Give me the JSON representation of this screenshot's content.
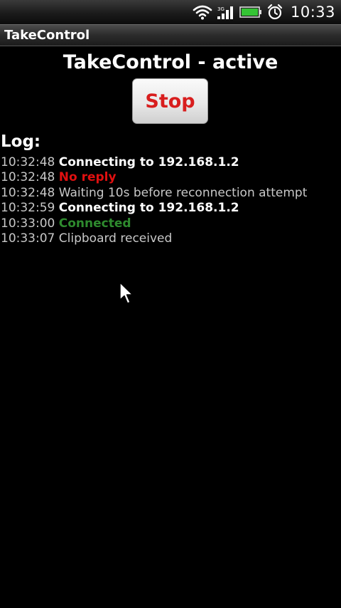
{
  "status_bar": {
    "time": "10:33",
    "icons": [
      "wifi-icon",
      "signal-icon",
      "battery-icon",
      "alarm-clock-icon"
    ],
    "battery_color": "#35c435"
  },
  "app": {
    "title": "TakeControl"
  },
  "main": {
    "heading": "TakeControl - active",
    "stop_button_label": "Stop",
    "log_label": "Log:",
    "log": [
      {
        "time": "10:32:48",
        "message": "Connecting to 192.168.1.2",
        "style": "bold-white"
      },
      {
        "time": "10:32:48",
        "message": "No reply",
        "style": "bold-red"
      },
      {
        "time": "10:32:48",
        "message": "Waiting 10s before reconnection attempt",
        "style": "normal"
      },
      {
        "time": "10:32:59",
        "message": "Connecting to 192.168.1.2",
        "style": "bold-white"
      },
      {
        "time": "10:33:00",
        "message": "Connected",
        "style": "bold-green"
      },
      {
        "time": "10:33:07",
        "message": "Clipboard received",
        "style": "normal"
      }
    ]
  },
  "colors": {
    "stop_text": "#d81e1e",
    "error": "#e01010",
    "success": "#2e8a2e",
    "muted_text": "#c8c8c8"
  }
}
